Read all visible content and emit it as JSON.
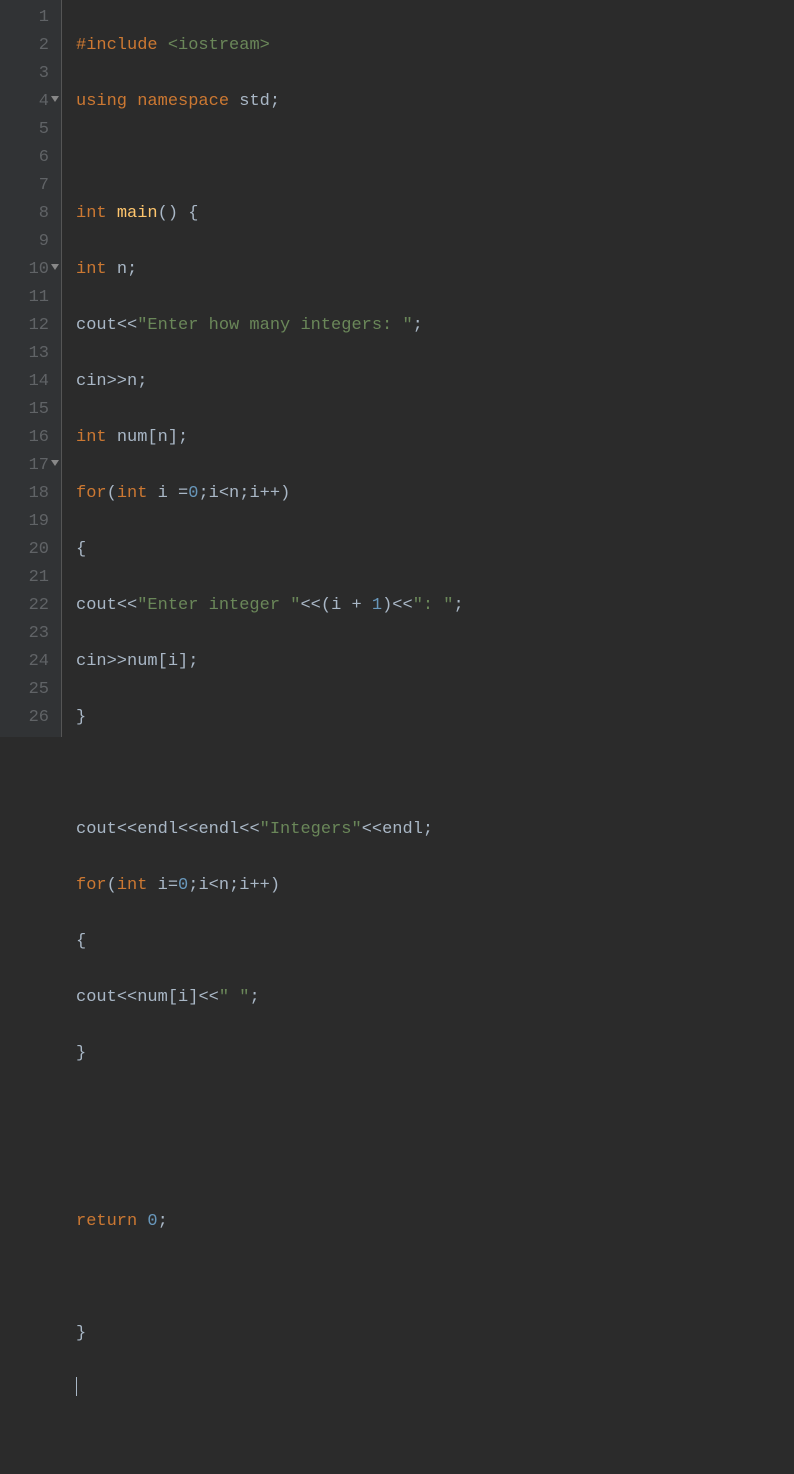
{
  "gutter": {
    "lines": [
      "1",
      "2",
      "3",
      "4",
      "5",
      "6",
      "7",
      "8",
      "9",
      "10",
      "11",
      "12",
      "13",
      "14",
      "15",
      "16",
      "17",
      "18",
      "19",
      "20",
      "21",
      "22",
      "23",
      "24",
      "25",
      "26"
    ],
    "foldable": [
      4,
      10,
      17
    ]
  },
  "code": {
    "l1": {
      "preproc": "#include",
      "space": " ",
      "path": "<iostream>"
    },
    "l2": {
      "using": "using",
      "ns": "namespace",
      "std": "std",
      "semi": ";"
    },
    "l4": {
      "int": "int",
      "main": "main",
      "parens": "()",
      "brace": " {"
    },
    "l5": {
      "int": "int",
      "n": "n",
      "semi": ";"
    },
    "l6": {
      "cout": "cout",
      "op1": "<<",
      "str": "\"Enter how many integers: \"",
      "semi": ";"
    },
    "l7": {
      "cin": "cin",
      "op": ">>",
      "n": "n",
      "semi": ";"
    },
    "l8": {
      "int": "int",
      "num": "num",
      "br1": "[",
      "n": "n",
      "br2": "]",
      "semi": ";"
    },
    "l9": {
      "for": "for",
      "p1": "(",
      "int": "int",
      "i": "i",
      "eq": " =",
      "zero": "0",
      "s1": ";",
      "iv": "i",
      "lt": "<",
      "nv": "n",
      "s2": ";",
      "iv2": "i",
      "pp": "++",
      "p2": ")"
    },
    "l10": {
      "brace": "{"
    },
    "l11": {
      "cout": "cout",
      "op1": "<<",
      "str1": "\"Enter integer \"",
      "op2": "<<",
      "p1": "(",
      "i": "i",
      "plus": " + ",
      "one": "1",
      "p2": ")",
      "op3": "<<",
      "str2": "\": \"",
      "semi": ";"
    },
    "l12": {
      "cin": "cin",
      "op": ">>",
      "num": "num",
      "br1": "[",
      "i": "i",
      "br2": "]",
      "semi": ";"
    },
    "l13": {
      "brace": "}"
    },
    "l15": {
      "cout": "cout",
      "op1": "<<",
      "endl1": "endl",
      "op2": "<<",
      "endl2": "endl",
      "op3": "<<",
      "str": "\"Integers\"",
      "op4": "<<",
      "endl3": "endl",
      "semi": ";"
    },
    "l16": {
      "for": "for",
      "p1": "(",
      "int": "int",
      "i": "i",
      "eq": "=",
      "zero": "0",
      "s1": ";",
      "iv": "i",
      "lt": "<",
      "nv": "n",
      "s2": ";",
      "iv2": "i",
      "pp": "++",
      "p2": ")"
    },
    "l17": {
      "brace": "{"
    },
    "l18": {
      "cout": "cout",
      "op1": "<<",
      "num": "num",
      "br1": "[",
      "i": "i",
      "br2": "]",
      "op2": "<<",
      "str": "\" \"",
      "semi": ";"
    },
    "l19": {
      "brace": "}"
    },
    "l22": {
      "return": "return",
      "zero": "0",
      "semi": ";"
    },
    "l24": {
      "brace": "}"
    }
  }
}
